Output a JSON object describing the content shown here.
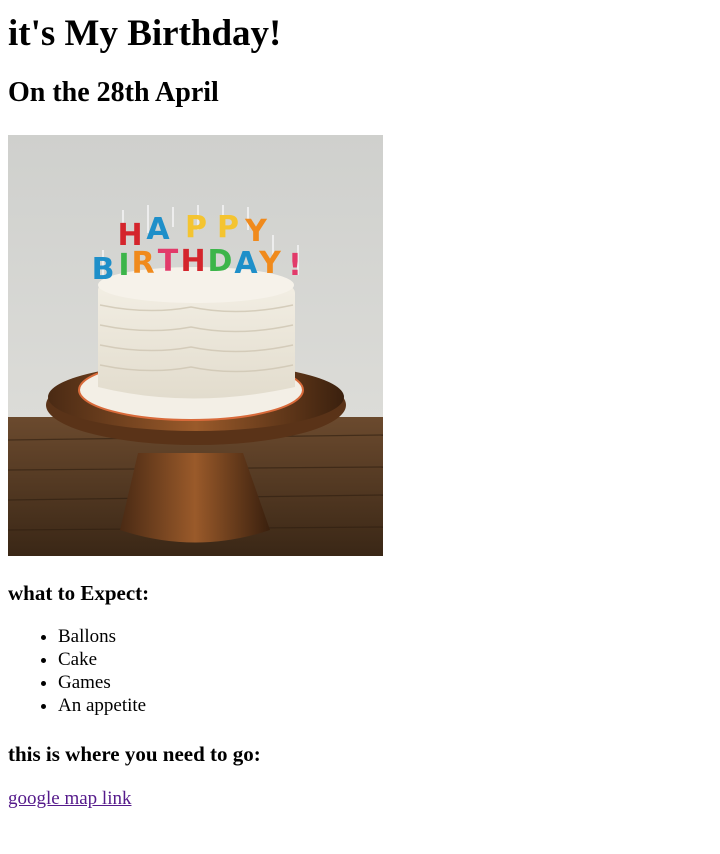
{
  "heading": "it's My Birthday!",
  "subheading": "On the 28th April",
  "image": {
    "icon": "birthday-cake-photo",
    "candle_letters": [
      "H",
      "A",
      "P",
      "P",
      "Y",
      "B",
      "I",
      "R",
      "T",
      "H",
      "D",
      "A",
      "Y",
      "!"
    ]
  },
  "expect": {
    "title": "what to Expect:",
    "items": [
      "Ballons",
      "Cake",
      "Games",
      "An appetite"
    ]
  },
  "directions": {
    "title": "this is where you need to go:",
    "link_text": "google map link"
  },
  "colors": {
    "link_visited": "#551a8b"
  }
}
